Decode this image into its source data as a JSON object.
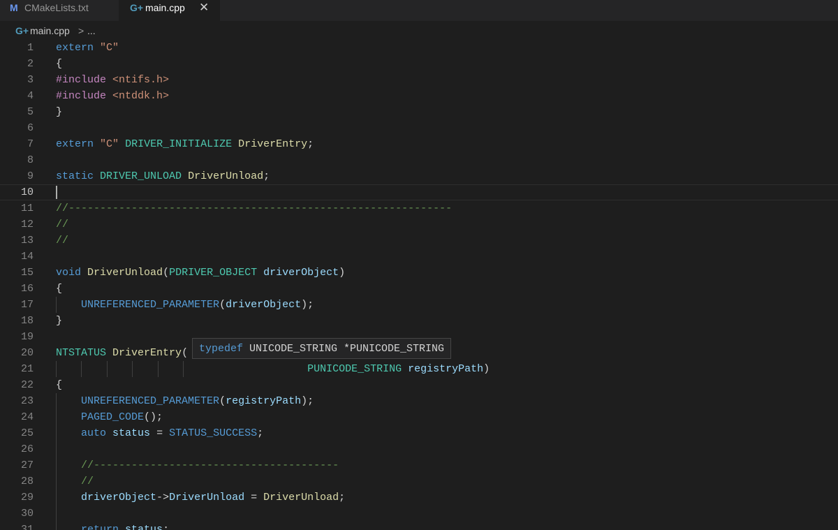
{
  "tabs": [
    {
      "icon": "M",
      "label": "CMakeLists.txt",
      "active": false
    },
    {
      "icon": "G+",
      "label": "main.cpp",
      "active": true,
      "close": "✕"
    }
  ],
  "breadcrumb": {
    "icon": "G+",
    "file": "main.cpp",
    "separator": ">",
    "rest": "..."
  },
  "colors": {
    "background": "#1e1e1e",
    "keyword": "#569cd6",
    "type": "#4ec9b0",
    "function": "#dcdcaa",
    "variable": "#9cdcfe",
    "string": "#ce9178",
    "preprocessor": "#c586c0",
    "comment": "#6a9955"
  },
  "editor": {
    "cursor_line": 10,
    "lines": [
      {
        "n": "1",
        "tokens": [
          [
            "kw",
            "extern"
          ],
          [
            "plain",
            " "
          ],
          [
            "str",
            "\"C\""
          ]
        ]
      },
      {
        "n": "2",
        "tokens": [
          [
            "plain",
            "{"
          ]
        ]
      },
      {
        "n": "3",
        "tokens": [
          [
            "pp",
            "#include"
          ],
          [
            "plain",
            " "
          ],
          [
            "str",
            "<ntifs.h>"
          ]
        ]
      },
      {
        "n": "4",
        "tokens": [
          [
            "pp",
            "#include"
          ],
          [
            "plain",
            " "
          ],
          [
            "str",
            "<ntddk.h>"
          ]
        ]
      },
      {
        "n": "5",
        "tokens": [
          [
            "plain",
            "}"
          ]
        ]
      },
      {
        "n": "6",
        "tokens": []
      },
      {
        "n": "7",
        "tokens": [
          [
            "kw",
            "extern"
          ],
          [
            "plain",
            " "
          ],
          [
            "str",
            "\"C\""
          ],
          [
            "plain",
            " "
          ],
          [
            "type",
            "DRIVER_INITIALIZE"
          ],
          [
            "plain",
            " "
          ],
          [
            "func",
            "DriverEntry"
          ],
          [
            "plain",
            ";"
          ]
        ]
      },
      {
        "n": "8",
        "tokens": []
      },
      {
        "n": "9",
        "tokens": [
          [
            "kw",
            "static"
          ],
          [
            "plain",
            " "
          ],
          [
            "type",
            "DRIVER_UNLOAD"
          ],
          [
            "plain",
            " "
          ],
          [
            "func",
            "DriverUnload"
          ],
          [
            "plain",
            ";"
          ]
        ]
      },
      {
        "n": "10",
        "tokens": []
      },
      {
        "n": "11",
        "tokens": [
          [
            "cm",
            "//-------------------------------------------------------------"
          ]
        ]
      },
      {
        "n": "12",
        "tokens": [
          [
            "cm",
            "//"
          ]
        ]
      },
      {
        "n": "13",
        "tokens": [
          [
            "cm",
            "//"
          ]
        ]
      },
      {
        "n": "14",
        "tokens": []
      },
      {
        "n": "15",
        "tokens": [
          [
            "kw",
            "void"
          ],
          [
            "plain",
            " "
          ],
          [
            "func",
            "DriverUnload"
          ],
          [
            "plain",
            "("
          ],
          [
            "type",
            "PDRIVER_OBJECT"
          ],
          [
            "plain",
            " "
          ],
          [
            "var",
            "driverObject"
          ],
          [
            "plain",
            ")"
          ]
        ]
      },
      {
        "n": "16",
        "tokens": [
          [
            "plain",
            "{"
          ]
        ]
      },
      {
        "n": "17",
        "tokens": [
          [
            "plain",
            "    "
          ],
          [
            "macro",
            "UNREFERENCED_PARAMETER"
          ],
          [
            "plain",
            "("
          ],
          [
            "var",
            "driverObject"
          ],
          [
            "plain",
            ");"
          ]
        ]
      },
      {
        "n": "18",
        "tokens": [
          [
            "plain",
            "}"
          ]
        ]
      },
      {
        "n": "19",
        "tokens": []
      },
      {
        "n": "20",
        "tokens": [
          [
            "type",
            "NTSTATUS"
          ],
          [
            "plain",
            " "
          ],
          [
            "func",
            "DriverEntry"
          ],
          [
            "plain",
            "("
          ]
        ]
      },
      {
        "n": "21",
        "tokens": [
          [
            "plain",
            "                                        "
          ],
          [
            "type",
            "PUNICODE_STRING"
          ],
          [
            "plain",
            " "
          ],
          [
            "var",
            "registryPath"
          ],
          [
            "plain",
            ")"
          ]
        ]
      },
      {
        "n": "22",
        "tokens": [
          [
            "plain",
            "{"
          ]
        ]
      },
      {
        "n": "23",
        "tokens": [
          [
            "plain",
            "    "
          ],
          [
            "macro",
            "UNREFERENCED_PARAMETER"
          ],
          [
            "plain",
            "("
          ],
          [
            "var",
            "registryPath"
          ],
          [
            "plain",
            ");"
          ]
        ]
      },
      {
        "n": "24",
        "tokens": [
          [
            "plain",
            "    "
          ],
          [
            "macro",
            "PAGED_CODE"
          ],
          [
            "plain",
            "();"
          ]
        ]
      },
      {
        "n": "25",
        "tokens": [
          [
            "plain",
            "    "
          ],
          [
            "kw",
            "auto"
          ],
          [
            "plain",
            " "
          ],
          [
            "var",
            "status"
          ],
          [
            "plain",
            " = "
          ],
          [
            "macro",
            "STATUS_SUCCESS"
          ],
          [
            "plain",
            ";"
          ]
        ]
      },
      {
        "n": "26",
        "tokens": []
      },
      {
        "n": "27",
        "tokens": [
          [
            "plain",
            "    "
          ],
          [
            "cm",
            "//---------------------------------------"
          ]
        ]
      },
      {
        "n": "28",
        "tokens": [
          [
            "plain",
            "    "
          ],
          [
            "cm",
            "//"
          ]
        ]
      },
      {
        "n": "29",
        "tokens": [
          [
            "plain",
            "    "
          ],
          [
            "var",
            "driverObject"
          ],
          [
            "plain",
            "->"
          ],
          [
            "var",
            "DriverUnload"
          ],
          [
            "plain",
            " = "
          ],
          [
            "func",
            "DriverUnload"
          ],
          [
            "plain",
            ";"
          ]
        ]
      },
      {
        "n": "30",
        "tokens": []
      },
      {
        "n": "31",
        "tokens": [
          [
            "plain",
            "    "
          ],
          [
            "kw",
            "return"
          ],
          [
            "plain",
            " "
          ],
          [
            "var",
            "status"
          ],
          [
            "plain",
            ";"
          ]
        ]
      }
    ]
  },
  "hover": {
    "keyword": "typedef",
    "text": " UNICODE_STRING *PUNICODE_STRING"
  }
}
